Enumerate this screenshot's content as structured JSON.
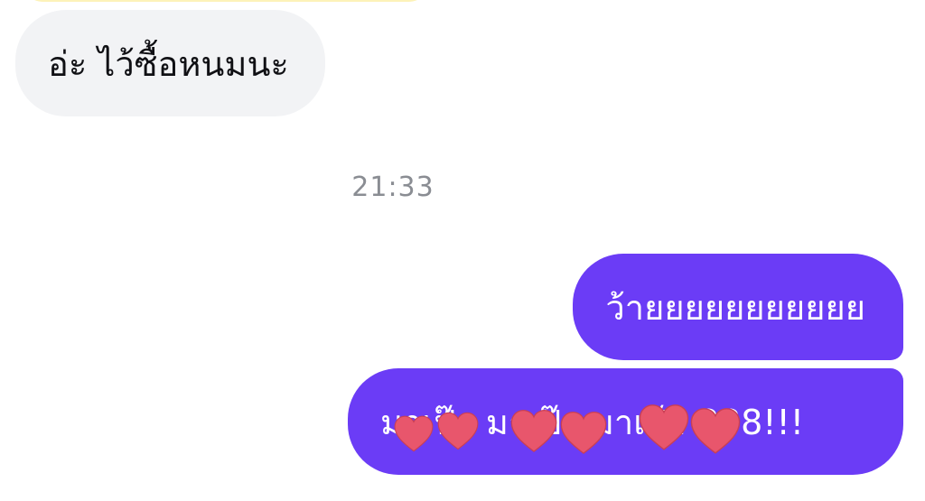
{
  "messages": [
    {
      "direction": "incoming",
      "text": "อ่ะ ไว้ซื้อหนมนะ"
    },
    {
      "direction": "outgoing",
      "text": "ว้ายยยยยยยยยยย"
    },
    {
      "direction": "outgoing",
      "text": "มาเป๊า มาเป๊า มาเป๊า 888!!!"
    }
  ],
  "timestamp": "21:33",
  "colors": {
    "incoming_bubble": "#f2f3f5",
    "outgoing_bubble": "#6b3cf6",
    "previous_bubble": "#fdf2b8",
    "timestamp_text": "#8a8d93",
    "heart_sticker": "#e8566c"
  },
  "overlay": {
    "icon": "heart-sticker-icon",
    "count": 6
  }
}
